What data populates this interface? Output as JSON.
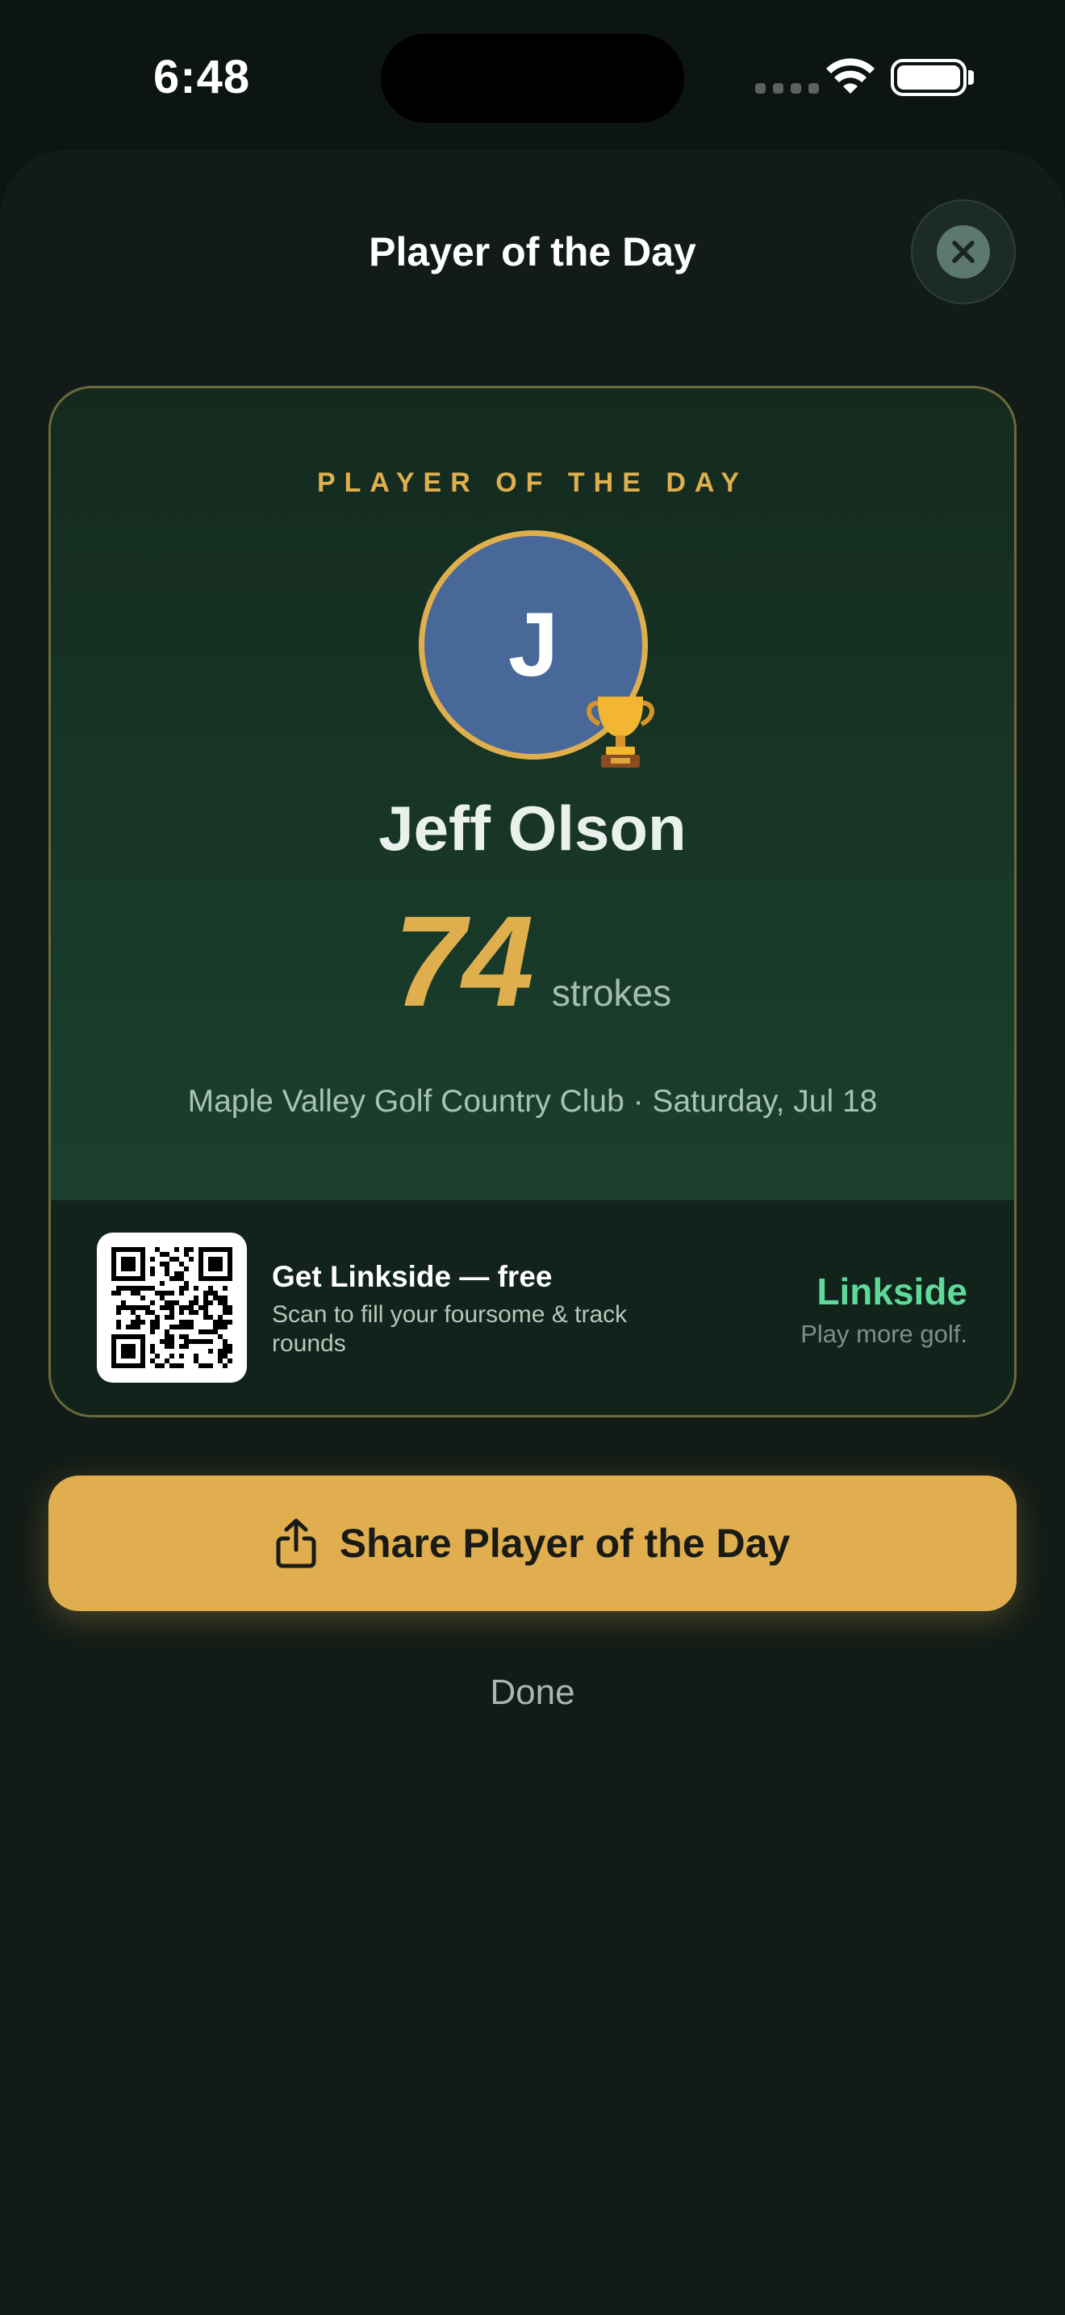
{
  "status_bar": {
    "time": "6:48",
    "signal_icon": "cellular-signal-icon",
    "wifi_icon": "wifi-icon",
    "battery_icon": "battery-icon",
    "battery_level": 1.0
  },
  "sheet": {
    "title": "Player of the Day",
    "close_icon": "close-icon"
  },
  "card": {
    "eyebrow": "PLAYER OF THE DAY",
    "avatar_initial": "J",
    "badge_icon": "trophy-icon",
    "player_name": "Jeff Olson",
    "score": "74",
    "score_unit": "strokes",
    "course_line": "Maple Valley Golf Country Club · Saturday, Jul 18",
    "promo": {
      "qr_icon": "qr-code-icon",
      "title": "Get Linkside — free",
      "subtitle": "Scan to fill your foursome & track rounds",
      "brand": "Linkside",
      "tagline": "Play more golf."
    }
  },
  "actions": {
    "share_icon": "share-icon",
    "share_label": "Share Player of the Day",
    "done_label": "Done"
  },
  "colors": {
    "gold": "#dfaf4e",
    "brand_green": "#5dd99a",
    "avatar_blue": "#486899",
    "sheet_background": "#121b17"
  }
}
